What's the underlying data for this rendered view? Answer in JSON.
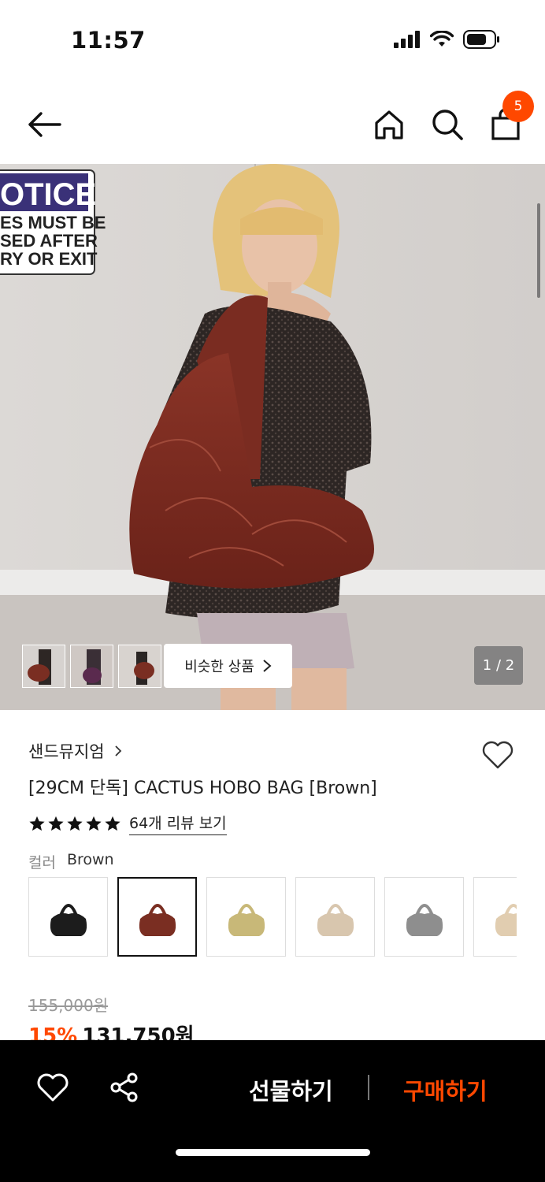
{
  "status_bar": {
    "time": "11:57"
  },
  "nav": {
    "cart_count": "5"
  },
  "hero": {
    "sign_lines": [
      "OTICE",
      "ES MUST BE",
      "SED AFTER",
      "RY OR EXIT"
    ],
    "similar_label": "비슷한 상품",
    "page_indicator": "1 / 2"
  },
  "product": {
    "brand": "샌드뮤지엄",
    "name": "[29CM 단독] CACTUS HOBO BAG [Brown]",
    "rating_stars": 5,
    "review_link": "64개 리뷰 보기",
    "color_label": "컬러",
    "color_value": "Brown",
    "swatches": [
      {
        "name": "Black",
        "color": "#1c1c1c"
      },
      {
        "name": "Brown",
        "color": "#7a2e22"
      },
      {
        "name": "Khaki",
        "color": "#c8b878"
      },
      {
        "name": "Beige",
        "color": "#d8c6ae"
      },
      {
        "name": "Grey",
        "color": "#8e8e8e"
      },
      {
        "name": "Cream",
        "color": "#e1cdb0"
      }
    ],
    "original_price": "155,000원",
    "discount": "15%",
    "sale_price": "131,750원"
  },
  "bottom_bar": {
    "gift_label": "선물하기",
    "buy_label": "구매하기"
  },
  "colors": {
    "accent": "#ff4800"
  }
}
